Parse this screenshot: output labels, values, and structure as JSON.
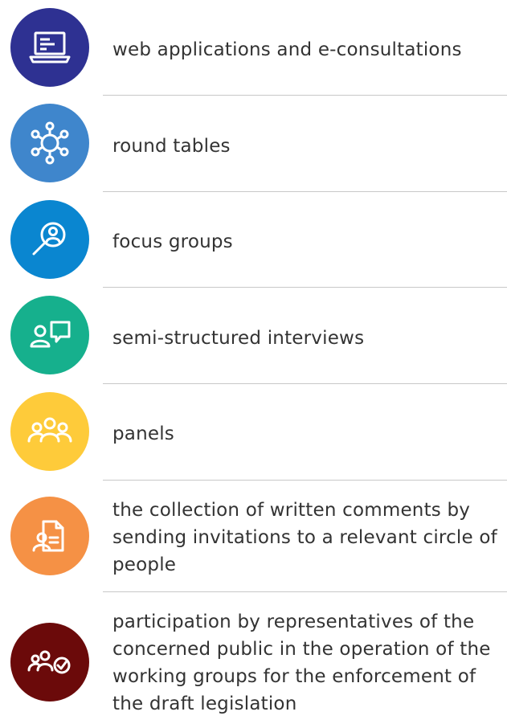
{
  "items": [
    {
      "label": "web applications and e-consultations",
      "color": "#2e3192",
      "icon": "laptop-icon"
    },
    {
      "label": "round tables",
      "color": "#3f86cc",
      "icon": "round-table-icon"
    },
    {
      "label": "focus groups",
      "color": "#0a86d0",
      "icon": "magnifier-person-icon"
    },
    {
      "label": "semi-structured interviews",
      "color": "#16b08d",
      "icon": "person-speech-bubble-icon"
    },
    {
      "label": "panels",
      "color": "#fecb3a",
      "icon": "group-of-people-icon"
    },
    {
      "label": "the collection of written comments by sending invitations to a relevant circle of people",
      "color": "#f59145",
      "icon": "person-document-icon"
    },
    {
      "label": "participation by representatives of the concerned public in the operation of the working groups for the enforcement of the draft legislation",
      "color": "#6b0a0a",
      "icon": "people-checkmark-icon"
    }
  ]
}
